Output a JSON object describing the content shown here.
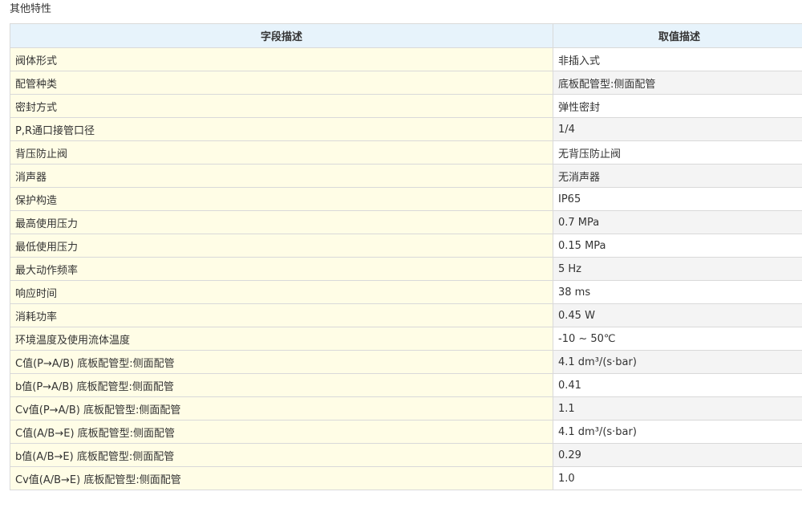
{
  "section": {
    "title": "其他特性"
  },
  "table": {
    "headers": {
      "field": "字段描述",
      "value": "取值描述"
    },
    "rows": [
      {
        "field": "阀体形式",
        "value": "非插入式"
      },
      {
        "field": "配管种类",
        "value": "底板配管型:侧面配管"
      },
      {
        "field": "密封方式",
        "value": "弹性密封"
      },
      {
        "field": "P,R通口接管口径",
        "value": "1/4"
      },
      {
        "field": "背压防止阀",
        "value": "无背压防止阀"
      },
      {
        "field": "消声器",
        "value": "无消声器"
      },
      {
        "field": "保护构造",
        "value": "IP65"
      },
      {
        "field": "最高使用压力",
        "value": "0.7 MPa"
      },
      {
        "field": "最低使用压力",
        "value": "0.15 MPa"
      },
      {
        "field": "最大动作频率",
        "value": "5 Hz"
      },
      {
        "field": "响应时间",
        "value": "38 ms"
      },
      {
        "field": "消耗功率",
        "value": "0.45 W"
      },
      {
        "field": "环境温度及使用流体温度",
        "value": "-10 ~ 50℃"
      },
      {
        "field": "C值(P→A/B) 底板配管型:侧面配管",
        "value": "4.1 dm³/(s·bar)"
      },
      {
        "field": "b值(P→A/B) 底板配管型:侧面配管",
        "value": "0.41"
      },
      {
        "field": "Cv值(P→A/B) 底板配管型:侧面配管",
        "value": "1.1"
      },
      {
        "field": "C值(A/B→E) 底板配管型:侧面配管",
        "value": "4.1 dm³/(s·bar)"
      },
      {
        "field": "b值(A/B→E) 底板配管型:侧面配管",
        "value": "0.29"
      },
      {
        "field": "Cv值(A/B→E) 底板配管型:侧面配管",
        "value": "1.0"
      }
    ]
  }
}
